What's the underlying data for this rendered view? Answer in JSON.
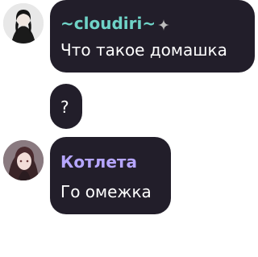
{
  "messages": [
    {
      "sender": "~cloudiri~",
      "sender_color": "#6fd3c7",
      "text": "Что такое домашка",
      "badge_icon": "sparkle-icon"
    },
    {
      "sender": "",
      "text": "?"
    },
    {
      "sender": "Котлета",
      "sender_color": "#b6a6ff",
      "text": "Го омежка"
    }
  ],
  "colors": {
    "bubble_bg": "#221e2a",
    "page_bg": "#ffffff",
    "text": "#ffffff"
  }
}
